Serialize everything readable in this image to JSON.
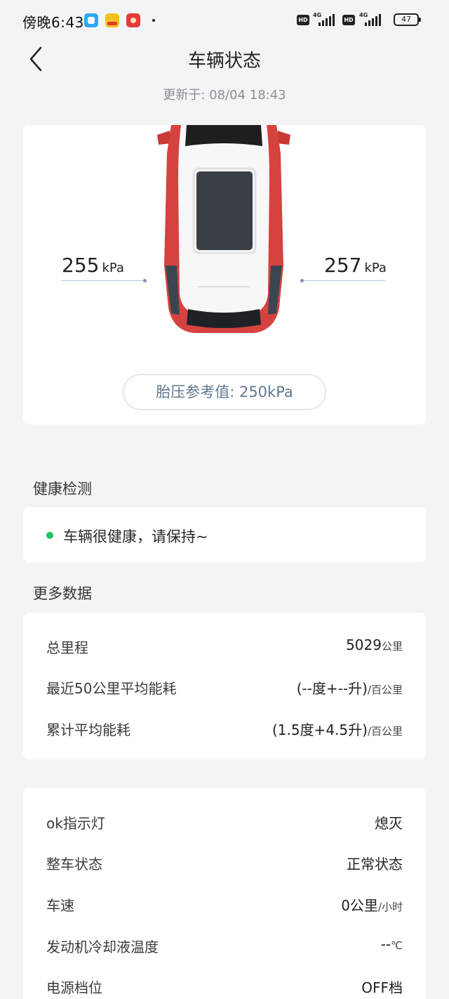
{
  "status_bar": {
    "time": "傍晚6:43",
    "hd_label": "HD",
    "network": "4G",
    "battery": "47"
  },
  "header": {
    "title": "车辆状态",
    "updated": "更新于: 08/04 18:43"
  },
  "tire": {
    "left_value": "255",
    "right_value": "257",
    "unit": "kPa",
    "reference": "胎压参考值: 250kPa",
    "car_color": "#d6423f"
  },
  "health": {
    "section_title": "健康检测",
    "status": "车辆很健康，请保持~",
    "status_color": "#1fc45d"
  },
  "more_data": {
    "section_title": "更多数据",
    "rows": [
      {
        "label": "总里程",
        "value": "5029",
        "unit": "公里"
      },
      {
        "label": "最近50公里平均能耗",
        "value": "(--度+--升)",
        "unit": "/百公里"
      },
      {
        "label": "累计平均能耗",
        "value": "(1.5度+4.5升)",
        "unit": "/百公里"
      }
    ]
  },
  "status_list": {
    "rows": [
      {
        "label": "ok指示灯",
        "value": "熄灭",
        "unit": ""
      },
      {
        "label": "整车状态",
        "value": "正常状态",
        "unit": ""
      },
      {
        "label": "车速",
        "value": "0公里",
        "unit": "/小时"
      },
      {
        "label": "发动机冷却液温度",
        "value": "--",
        "unit": "℃"
      },
      {
        "label": "电源档位",
        "value": "OFF档",
        "unit": ""
      }
    ]
  }
}
